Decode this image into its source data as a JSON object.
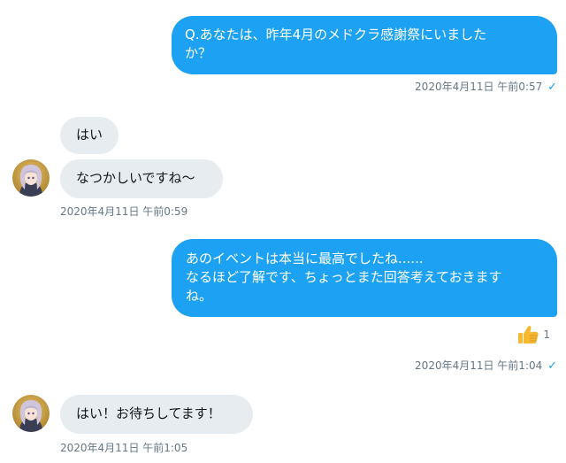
{
  "conversation": {
    "messages": [
      {
        "direction": "outgoing",
        "text": "Q.あなたは、昨年4月のメドクラ感謝祭にいました\nか？",
        "timestamp": "2020年4月11日 午前0:57",
        "read_receipt": "✓"
      },
      {
        "direction": "incoming",
        "text": "はい"
      },
      {
        "direction": "incoming",
        "text": "なつかしいですね〜",
        "timestamp": "2020年4月11日 午前0:59"
      },
      {
        "direction": "outgoing",
        "text": "あのイベントは本当に最高でしたね......\nなるほど了解です、ちょっとまた回答考えておきます\nね。",
        "reaction": {
          "icon": "thumbs-up-icon",
          "count": "1"
        },
        "timestamp": "2020年4月11日 午前1:04",
        "read_receipt": "✓"
      },
      {
        "direction": "incoming",
        "text": "はい！お待ちしてます！",
        "timestamp": "2020年4月11日 午前1:05"
      }
    ]
  },
  "colors": {
    "outgoing_bubble": "#1da1f2",
    "incoming_bubble": "#e6ecf0",
    "timestamp_text": "#657786",
    "read_receipt": "#1da1f2",
    "reaction_thumb": "#f5b82e"
  }
}
